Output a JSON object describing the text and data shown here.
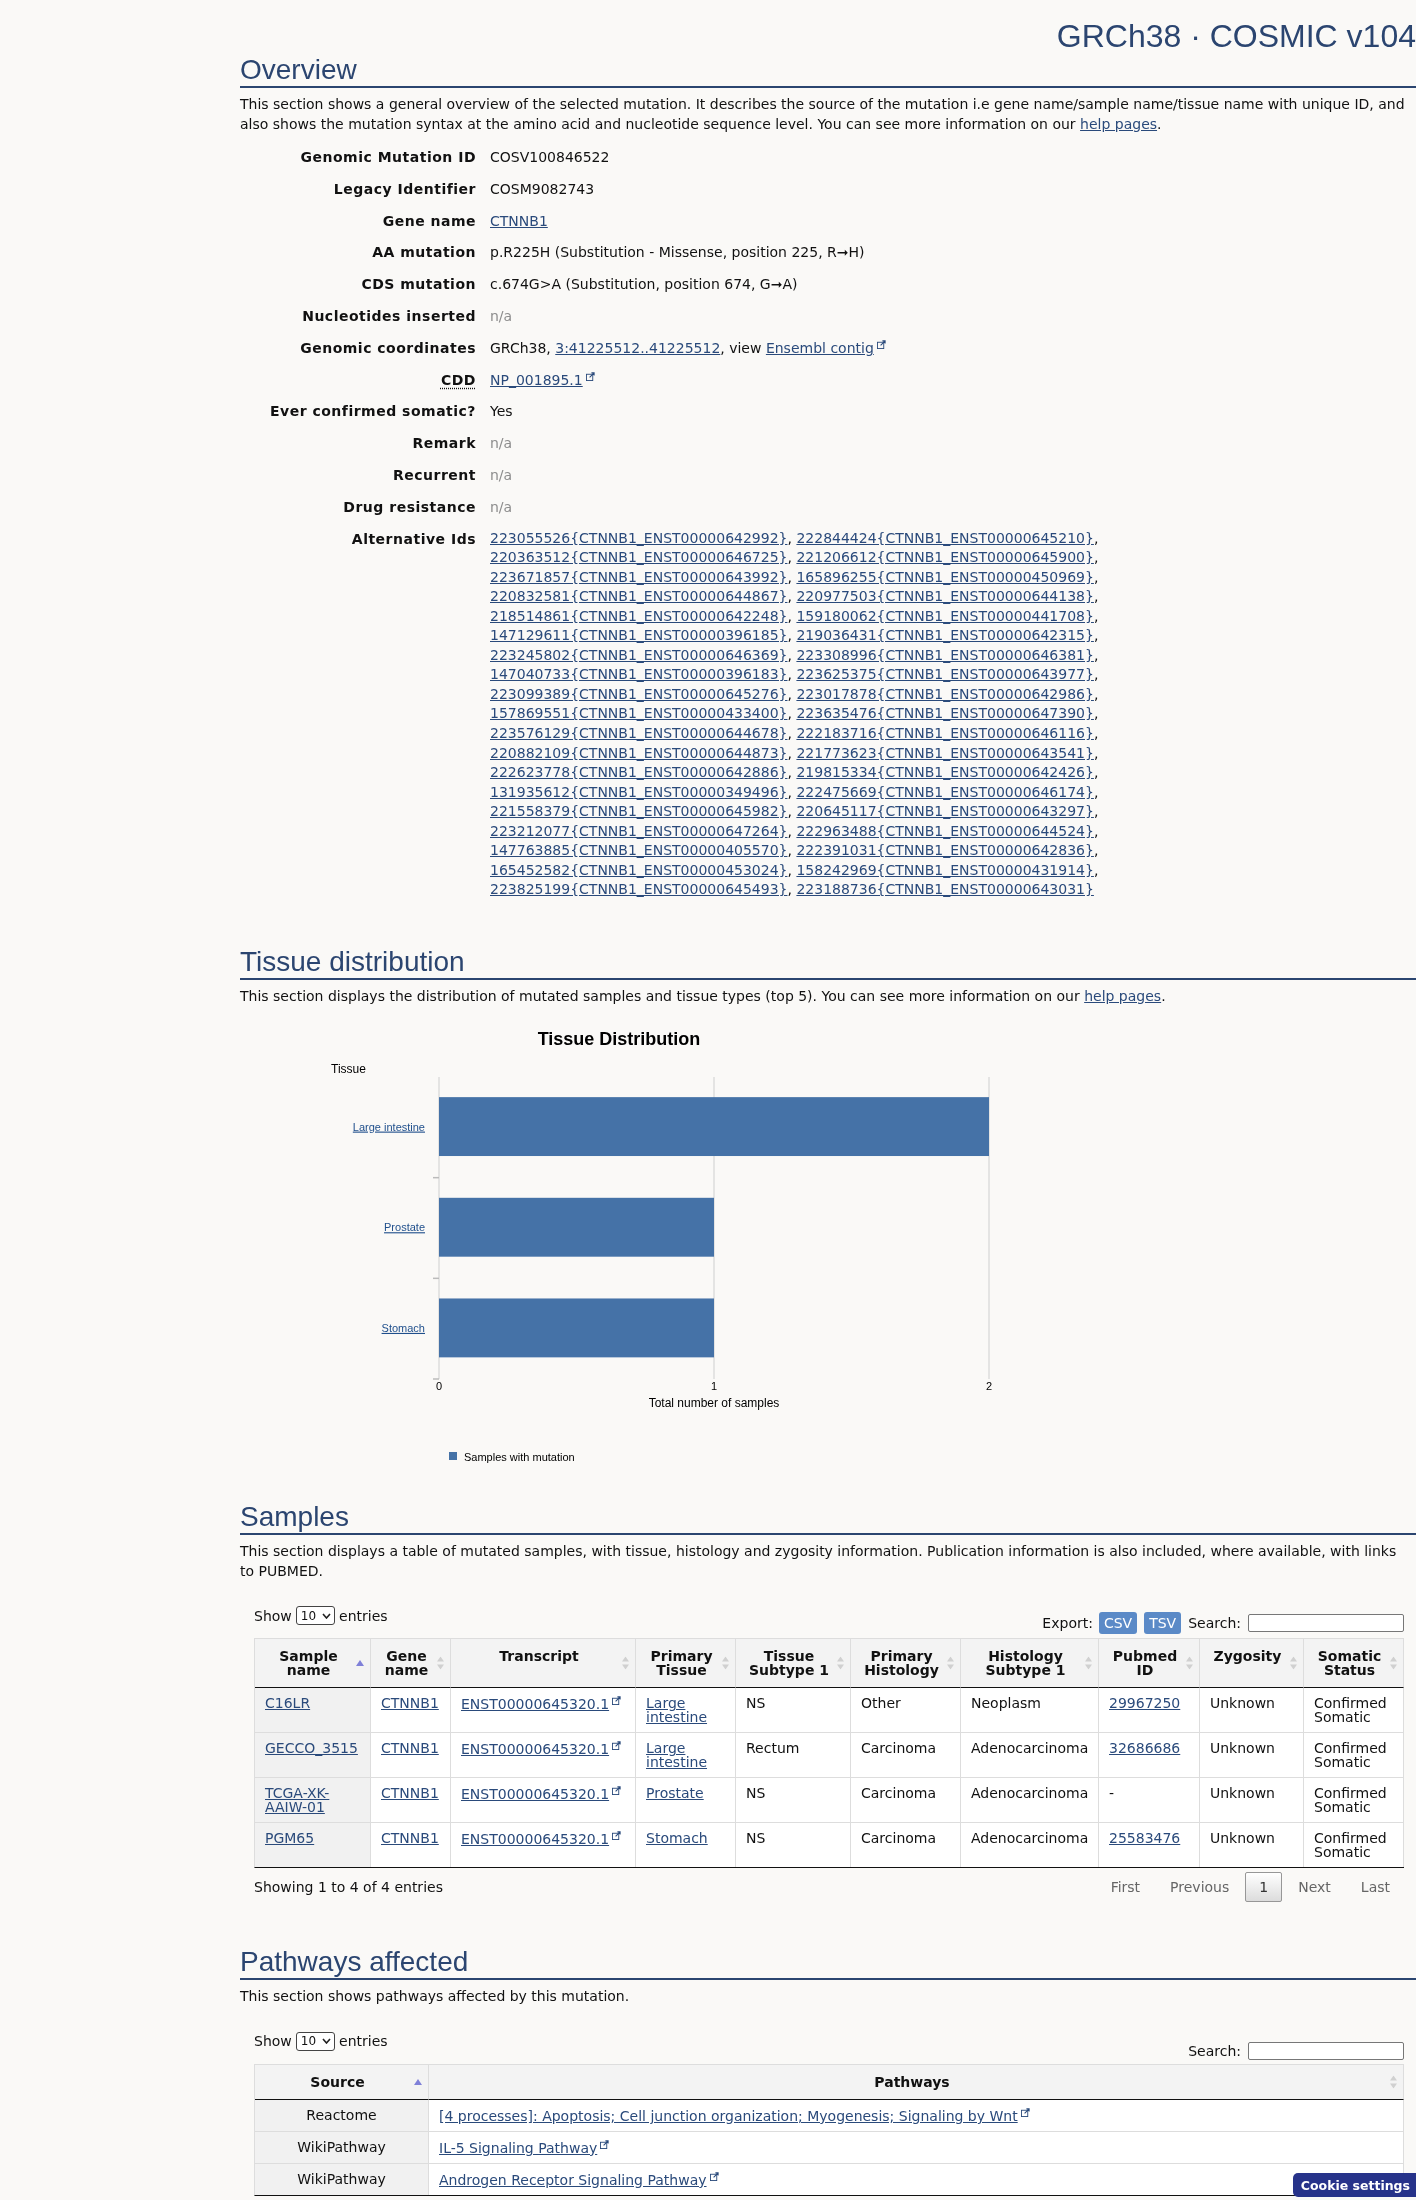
{
  "header": {
    "title": "GRCh38 · COSMIC v104"
  },
  "overview": {
    "heading": "Overview",
    "description": [
      {
        "kind": "text",
        "text": "This section shows a general overview of the selected mutation. It describes the source of the mutation i.e gene name/sample name/tissue name with unique ID, and also shows the mutation syntax at the amino acid and nucleotide sequence level. You can see more information on our "
      },
      {
        "kind": "link",
        "text": "help pages"
      },
      {
        "kind": "text",
        "text": "."
      }
    ],
    "fields": [
      {
        "label": "Genomic Mutation ID",
        "kind": "text",
        "value": "COSV100846522"
      },
      {
        "label": "Legacy Identifier",
        "kind": "text",
        "value": "COSM9082743"
      },
      {
        "label": "Gene name",
        "kind": "link",
        "value": "CTNNB1"
      },
      {
        "label": "AA mutation",
        "kind": "text",
        "value": "p.R225H (Substitution - Missense, position 225, R➞H)"
      },
      {
        "label": "CDS mutation",
        "kind": "text",
        "value": "c.674G>A (Substitution, position 674, G➞A)"
      },
      {
        "label": "Nucleotides inserted",
        "kind": "muted",
        "value": "n/a"
      },
      {
        "label": "Genomic coordinates",
        "kind": "parts",
        "parts": [
          {
            "kind": "text",
            "text": "GRCh38, "
          },
          {
            "kind": "link",
            "text": "3:41225512..41225512"
          },
          {
            "kind": "text",
            "text": ", view "
          },
          {
            "kind": "link",
            "text": "Ensembl contig",
            "external": true
          }
        ]
      },
      {
        "label": "CDD",
        "abbreviation": true,
        "kind": "link",
        "value": "NP_001895.1",
        "external": true
      },
      {
        "label": "Ever confirmed somatic?",
        "kind": "text",
        "value": "Yes"
      },
      {
        "label": "Remark",
        "kind": "muted",
        "value": "n/a"
      },
      {
        "label": "Recurrent",
        "kind": "muted",
        "value": "n/a"
      },
      {
        "label": "Drug resistance",
        "kind": "muted",
        "value": "n/a"
      },
      {
        "label": "Alternative Ids",
        "kind": "list",
        "separator": ",",
        "items": [
          "223055526{CTNNB1_ENST00000642992}",
          "222844424{CTNNB1_ENST00000645210}",
          "220363512{CTNNB1_ENST00000646725}",
          "221206612{CTNNB1_ENST00000645900}",
          "223671857{CTNNB1_ENST00000643992}",
          "165896255{CTNNB1_ENST00000450969}",
          "220832581{CTNNB1_ENST00000644867}",
          "220977503{CTNNB1_ENST00000644138}",
          "218514861{CTNNB1_ENST00000642248}",
          "159180062{CTNNB1_ENST00000441708}",
          "147129611{CTNNB1_ENST00000396185}",
          "219036431{CTNNB1_ENST00000642315}",
          "223245802{CTNNB1_ENST00000646369}",
          "223308996{CTNNB1_ENST00000646381}",
          "147040733{CTNNB1_ENST00000396183}",
          "223625375{CTNNB1_ENST00000643977}",
          "223099389{CTNNB1_ENST00000645276}",
          "223017878{CTNNB1_ENST00000642986}",
          "157869551{CTNNB1_ENST00000433400}",
          "223635476{CTNNB1_ENST00000647390}",
          "223576129{CTNNB1_ENST00000644678}",
          "222183716{CTNNB1_ENST00000646116}",
          "220882109{CTNNB1_ENST00000644873}",
          "221773623{CTNNB1_ENST00000643541}",
          "222623778{CTNNB1_ENST00000642886}",
          "219815334{CTNNB1_ENST00000642426}",
          "131935612{CTNNB1_ENST00000349496}",
          "222475669{CTNNB1_ENST00000646174}",
          "221558379{CTNNB1_ENST00000645982}",
          "220645117{CTNNB1_ENST00000643297}",
          "223212077{CTNNB1_ENST00000647264}",
          "222963488{CTNNB1_ENST00000644524}",
          "147763885{CTNNB1_ENST00000405570}",
          "222391031{CTNNB1_ENST00000642836}",
          "165452582{CTNNB1_ENST00000453024}",
          "158242969{CTNNB1_ENST00000431914}",
          "223825199{CTNNB1_ENST00000645493}",
          "223188736{CTNNB1_ENST00000643031}"
        ]
      }
    ]
  },
  "tissue_distribution": {
    "heading": "Tissue distribution",
    "description": [
      {
        "kind": "text",
        "text": "This section displays the distribution of mutated samples and tissue types (top 5). You can see more information on our "
      },
      {
        "kind": "link",
        "text": "help pages"
      },
      {
        "kind": "text",
        "text": "."
      }
    ],
    "chart_data": {
      "type": "bar",
      "orientation": "horizontal",
      "title": "Tissue Distribution",
      "xlabel": "Total number of samples",
      "ylabel": "Tissue",
      "categories": [
        "Large intestine",
        "Prostate",
        "Stomach"
      ],
      "series": [
        {
          "name": "Samples with mutation",
          "color": "#4572a7",
          "values": [
            2,
            1,
            1
          ]
        }
      ],
      "xlim": [
        0,
        2
      ],
      "xticks": [
        0,
        1,
        2
      ]
    }
  },
  "samples": {
    "heading": "Samples",
    "description": [
      {
        "kind": "text",
        "text": "This section displays a table of mutated samples, with tissue, histology and zygosity information. Publication information is also included, where available, with links to PUBMED."
      }
    ],
    "table": {
      "length": {
        "prefix": "Show",
        "value": "10",
        "suffix": "entries"
      },
      "export": {
        "label": "Export:",
        "buttons": [
          "CSV",
          "TSV"
        ]
      },
      "search": {
        "label": "Search:"
      },
      "columns": [
        {
          "label": "Sample name",
          "sorted": true
        },
        {
          "label": "Gene name",
          "sorted": false
        },
        {
          "label": "Transcript",
          "sorted": false
        },
        {
          "label": "Primary Tissue",
          "sorted": false
        },
        {
          "label": "Tissue Subtype 1",
          "sorted": false
        },
        {
          "label": "Primary Histology",
          "sorted": false
        },
        {
          "label": "Histology Subtype 1",
          "sorted": false
        },
        {
          "label": "Pubmed ID",
          "sorted": false
        },
        {
          "label": "Zygosity",
          "sorted": false
        },
        {
          "label": "Somatic Status",
          "sorted": false
        }
      ],
      "rows": [
        [
          {
            "kind": "link",
            "text": "C16LR"
          },
          {
            "kind": "link",
            "text": "CTNNB1"
          },
          {
            "kind": "link",
            "text": "ENST00000645320.1",
            "external": true
          },
          {
            "kind": "link",
            "text": "Large intestine"
          },
          {
            "kind": "text",
            "text": "NS"
          },
          {
            "kind": "text",
            "text": "Other"
          },
          {
            "kind": "text",
            "text": "Neoplasm"
          },
          {
            "kind": "link",
            "text": "29967250"
          },
          {
            "kind": "text",
            "text": "Unknown"
          },
          {
            "kind": "text",
            "text": "Confirmed Somatic"
          }
        ],
        [
          {
            "kind": "link",
            "text": "GECCO_3515"
          },
          {
            "kind": "link",
            "text": "CTNNB1"
          },
          {
            "kind": "link",
            "text": "ENST00000645320.1",
            "external": true
          },
          {
            "kind": "link",
            "text": "Large intestine"
          },
          {
            "kind": "text",
            "text": "Rectum"
          },
          {
            "kind": "text",
            "text": "Carcinoma"
          },
          {
            "kind": "text",
            "text": "Adenocarcinoma"
          },
          {
            "kind": "link",
            "text": "32686686"
          },
          {
            "kind": "text",
            "text": "Unknown"
          },
          {
            "kind": "text",
            "text": "Confirmed Somatic"
          }
        ],
        [
          {
            "kind": "link",
            "text": "TCGA-XK-AAIW-01"
          },
          {
            "kind": "link",
            "text": "CTNNB1"
          },
          {
            "kind": "link",
            "text": "ENST00000645320.1",
            "external": true
          },
          {
            "kind": "link",
            "text": "Prostate"
          },
          {
            "kind": "text",
            "text": "NS"
          },
          {
            "kind": "text",
            "text": "Carcinoma"
          },
          {
            "kind": "text",
            "text": "Adenocarcinoma"
          },
          {
            "kind": "text",
            "text": "-"
          },
          {
            "kind": "text",
            "text": "Unknown"
          },
          {
            "kind": "text",
            "text": "Confirmed Somatic"
          }
        ],
        [
          {
            "kind": "link",
            "text": "PGM65"
          },
          {
            "kind": "link",
            "text": "CTNNB1"
          },
          {
            "kind": "link",
            "text": "ENST00000645320.1",
            "external": true
          },
          {
            "kind": "link",
            "text": "Stomach"
          },
          {
            "kind": "text",
            "text": "NS"
          },
          {
            "kind": "text",
            "text": "Carcinoma"
          },
          {
            "kind": "text",
            "text": "Adenocarcinoma"
          },
          {
            "kind": "link",
            "text": "25583476"
          },
          {
            "kind": "text",
            "text": "Unknown"
          },
          {
            "kind": "text",
            "text": "Confirmed Somatic"
          }
        ]
      ],
      "info": "Showing 1 to 4 of 4 entries",
      "pagination": [
        {
          "label": "First",
          "selected": false,
          "disabled": true
        },
        {
          "label": "Previous",
          "selected": false,
          "disabled": true
        },
        {
          "label": "1",
          "selected": true,
          "disabled": false
        },
        {
          "label": "Next",
          "selected": false,
          "disabled": true
        },
        {
          "label": "Last",
          "selected": false,
          "disabled": true
        }
      ]
    }
  },
  "pathways": {
    "heading": "Pathways affected",
    "description": [
      {
        "kind": "text",
        "text": "This section shows pathways affected by this mutation."
      }
    ],
    "table": {
      "length": {
        "prefix": "Show",
        "value": "10",
        "suffix": "entries"
      },
      "search": {
        "label": "Search:"
      },
      "columns": [
        {
          "label": "Source",
          "sorted": true
        },
        {
          "label": "Pathways",
          "sorted": false
        }
      ],
      "rows": [
        [
          {
            "kind": "text",
            "text": "Reactome"
          },
          {
            "kind": "link",
            "text": "[4 processes]: Apoptosis; Cell junction organization; Myogenesis; Signaling by Wnt",
            "external": true
          }
        ],
        [
          {
            "kind": "text",
            "text": "WikiPathway"
          },
          {
            "kind": "link",
            "text": "IL-5 Signaling Pathway",
            "external": true
          }
        ],
        [
          {
            "kind": "text",
            "text": "WikiPathway"
          },
          {
            "kind": "link",
            "text": "Androgen Receptor Signaling Pathway",
            "external": true
          }
        ]
      ]
    }
  },
  "cookie_button": {
    "label": "Cookie settings"
  }
}
